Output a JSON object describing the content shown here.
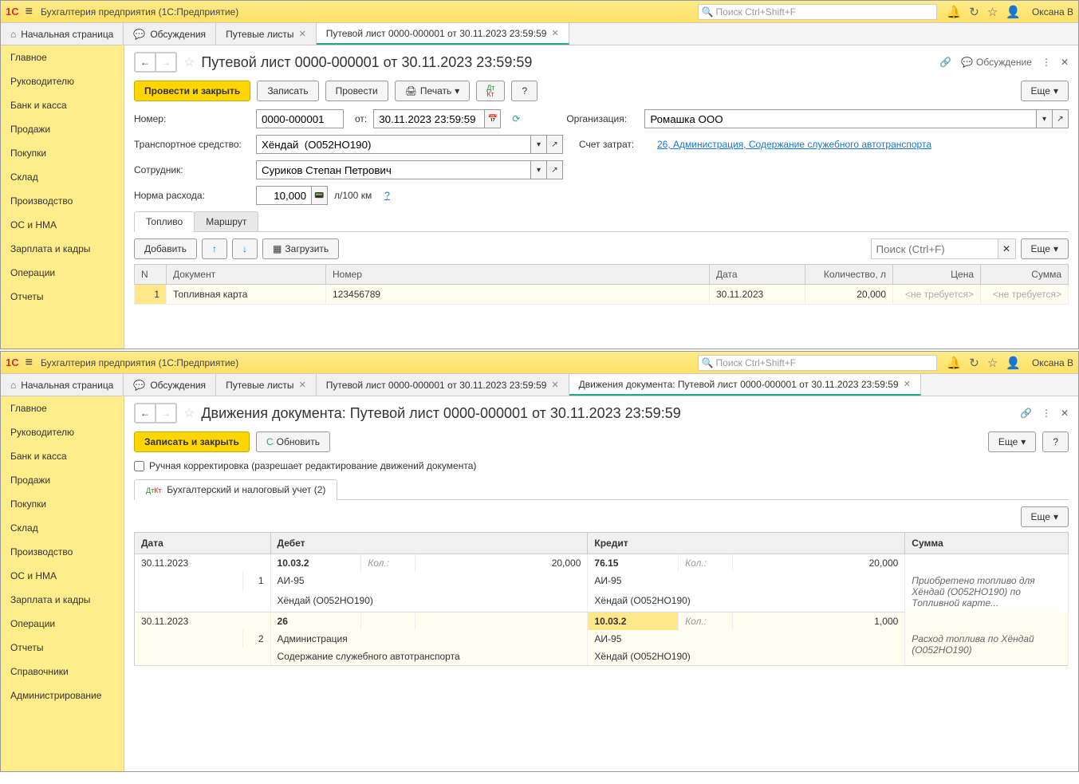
{
  "app_title": "Бухгалтерия предприятия  (1С:Предприятие)",
  "search_placeholder": "Поиск Ctrl+Shift+F",
  "user": "Оксана В",
  "tabs_home": "Начальная страница",
  "tabs_discuss": "Обсуждения",
  "tabs_waybills": "Путевые листы",
  "tabs_doc": "Путевой лист 0000-000001 от 30.11.2023 23:59:59",
  "tabs_movements": "Движения документа: Путевой лист 0000-000001 от 30.11.2023 23:59:59",
  "sidebar": {
    "items": [
      "Главное",
      "Руководителю",
      "Банк и касса",
      "Продажи",
      "Покупки",
      "Склад",
      "Производство",
      "ОС и НМА",
      "Зарплата и кадры",
      "Операции",
      "Отчеты",
      "Справочники",
      "Администрирование"
    ]
  },
  "doc": {
    "title": "Путевой лист 0000-000001 от 30.11.2023 23:59:59",
    "discuss": "Обсуждение",
    "btn_post_close": "Провести и закрыть",
    "btn_write": "Записать",
    "btn_post": "Провести",
    "btn_print": "Печать",
    "btn_more": "Еще",
    "label_number": "Номер:",
    "value_number": "0000-000001",
    "label_from": "от:",
    "value_date": "30.11.2023 23:59:59",
    "label_org": "Организация:",
    "value_org": "Ромашка ООО",
    "label_vehicle": "Транспортное средство:",
    "value_vehicle": "Хёндай  (О052НО190)",
    "label_cost": "Счет затрат:",
    "value_cost": "26, Администрация, Содержание служебного автотранспорта",
    "label_employee": "Сотрудник:",
    "value_employee": "Суриков Степан Петрович",
    "label_rate": "Норма расхода:",
    "value_rate": "10,000",
    "rate_unit": "л/100 км",
    "tab_fuel": "Топливо",
    "tab_route": "Маршрут",
    "btn_add": "Добавить",
    "btn_load": "Загрузить",
    "search_table": "Поиск (Ctrl+F)",
    "cols": {
      "n": "N",
      "doc": "Документ",
      "num": "Номер",
      "date": "Дата",
      "qty": "Количество, л",
      "price": "Цена",
      "sum": "Сумма"
    },
    "row": {
      "n": "1",
      "doc": "Топливная карта",
      "num": "123456789",
      "date": "30.11.2023",
      "qty": "20,000",
      "price": "<не требуется>",
      "sum": "<не требуется>"
    }
  },
  "mov": {
    "title": "Движения документа: Путевой лист 0000-000001 от 30.11.2023 23:59:59",
    "btn_write_close": "Записать и закрыть",
    "btn_refresh": "Обновить",
    "btn_more": "Еще",
    "manual_label": "Ручная корректировка (разрешает редактирование движений документа)",
    "tab_acc": "Бухгалтерский и налоговый учет (2)",
    "cols": {
      "date": "Дата",
      "debit": "Дебет",
      "credit": "Кредит",
      "sum": "Сумма"
    },
    "qty_label": "Кол.:",
    "r1": {
      "date": "30.11.2023",
      "n": "1",
      "d_acc": "10.03.2",
      "d_qty": "20,000",
      "d_l1": "АИ-95",
      "d_l2": "Хёндай  (О052НО190)",
      "c_acc": "76.15",
      "c_qty": "20,000",
      "c_l1": "АИ-95",
      "c_l2": "Хёндай  (О052НО190)",
      "desc": "Приобретено топливо для Хёндай (О052НО190) по Топливной карте..."
    },
    "r2": {
      "date": "30.11.2023",
      "n": "2",
      "d_acc": "26",
      "d_l1": "Администрация",
      "d_l2": "Содержание служебного автотранспорта",
      "c_acc": "10.03.2",
      "c_qty": "1,000",
      "c_l1": "АИ-95",
      "c_l2": "Хёндай  (О052НО190)",
      "desc": "Расход топлива по Хёндай (О052НО190)"
    }
  }
}
